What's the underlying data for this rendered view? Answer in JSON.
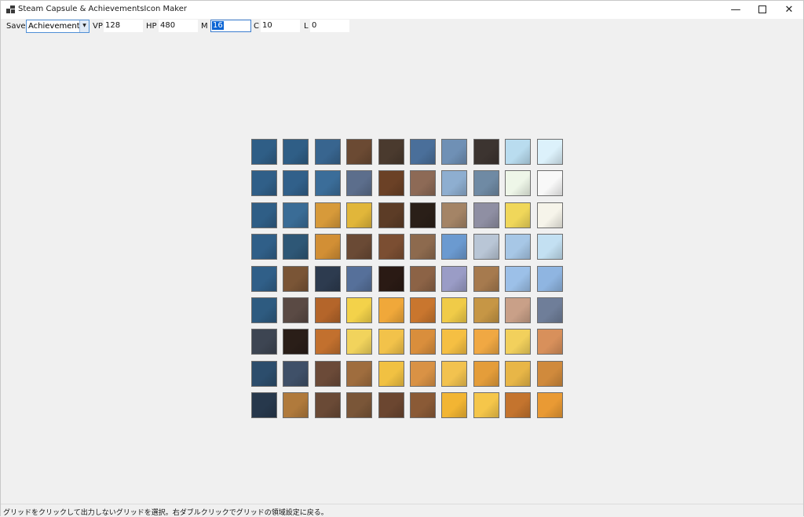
{
  "window": {
    "title": "Steam Capsule & AchievementsIcon Maker",
    "minimize_glyph": "—",
    "close_glyph": "✕"
  },
  "toolbar": {
    "save_label": "Save",
    "mode_select": {
      "value": "Achievements"
    },
    "vp_label": "VP",
    "vp_value": "128",
    "hp_label": "HP",
    "hp_value": "480",
    "m_label": "M",
    "m_value": "16",
    "c_label": "C",
    "c_value": "10",
    "l_label": "L",
    "l_value": "0"
  },
  "grid": {
    "columns": 10,
    "rows": 9,
    "tile_colors": [
      [
        "#2f5e86",
        "#2f5e86",
        "#38658f",
        "#6b4a33",
        "#4a3a2e",
        "#4a6f9a",
        "#6f90b5",
        "#3c3430",
        "#b9dcef",
        "#dcf1fb"
      ],
      [
        "#305f88",
        "#31608a",
        "#3b6d99",
        "#5c6e8c",
        "#6b4126",
        "#8d6a56",
        "#8eaed0",
        "#6f8aa4",
        "#eef6e8",
        "#f8f8f8"
      ],
      [
        "#2f5e86",
        "#3a6c96",
        "#d79a3a",
        "#e1b63a",
        "#5c3c26",
        "#2a1f18",
        "#a48466",
        "#8f8fa3",
        "#f0d75a",
        "#f6f4ea"
      ],
      [
        "#305f88",
        "#2e5776",
        "#d28f35",
        "#6a4a35",
        "#7b4e32",
        "#8d6a4e",
        "#6b9ad0",
        "#b9c6d6",
        "#a7c7e6",
        "#c3e0f2"
      ],
      [
        "#305f88",
        "#7a5536",
        "#2d3b4f",
        "#56709a",
        "#2a1a14",
        "#8c6346",
        "#9a9cc6",
        "#a67a4e",
        "#9cc0e8",
        "#8fb5e1"
      ],
      [
        "#2e5b80",
        "#5a4a44",
        "#b4652a",
        "#f3d24a",
        "#f0a83a",
        "#c9762e",
        "#f0cb48",
        "#c69645",
        "#c9a088",
        "#6f7e99"
      ],
      [
        "#3d4552",
        "#2a1e18",
        "#c2702e",
        "#f1d35c",
        "#f2c24a",
        "#d98e3c",
        "#f5bf43",
        "#f0a843",
        "#f2d05c",
        "#d8905b"
      ],
      [
        "#2c4d6c",
        "#3f5068",
        "#6b4a38",
        "#9f6d3e",
        "#f1c142",
        "#d99245",
        "#f2c24f",
        "#e49d3a",
        "#e8b647",
        "#d08a3c"
      ],
      [
        "#27384c",
        "#b07a3c",
        "#6a4a36",
        "#7a5638",
        "#6b4630",
        "#8a5a36",
        "#f2b533",
        "#f5c64a",
        "#c4742e",
        "#e99a34"
      ]
    ]
  },
  "status": {
    "text": "グリッドをクリックして出力しないグリッドを選択。右ダブルクリックでグリッドの領域設定に戻る。"
  }
}
